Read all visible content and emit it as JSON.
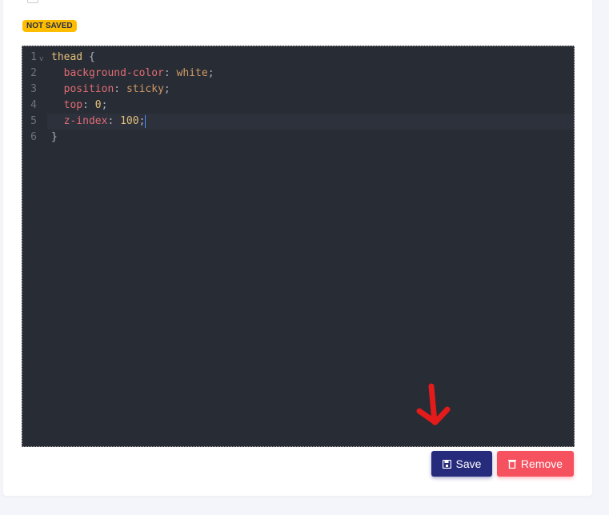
{
  "status_badge": "NOT SAVED",
  "editor": {
    "lines": [
      {
        "n": "1"
      },
      {
        "n": "2"
      },
      {
        "n": "3"
      },
      {
        "n": "4"
      },
      {
        "n": "5"
      },
      {
        "n": "6"
      }
    ],
    "tokens": {
      "selector": "thead",
      "open": " {",
      "p1": "background-color",
      "v1": "white",
      "p2": "position",
      "v2": "sticky",
      "p3": "top",
      "v3": "0",
      "p4": "z-index",
      "v4": "100",
      "close": "}"
    }
  },
  "buttons": {
    "save": "Save",
    "remove": "Remove"
  },
  "colors": {
    "save": "#272b7c",
    "remove": "#f5515f",
    "badge": "#ffbd00",
    "annotation_arrow": "#e31b1b"
  }
}
